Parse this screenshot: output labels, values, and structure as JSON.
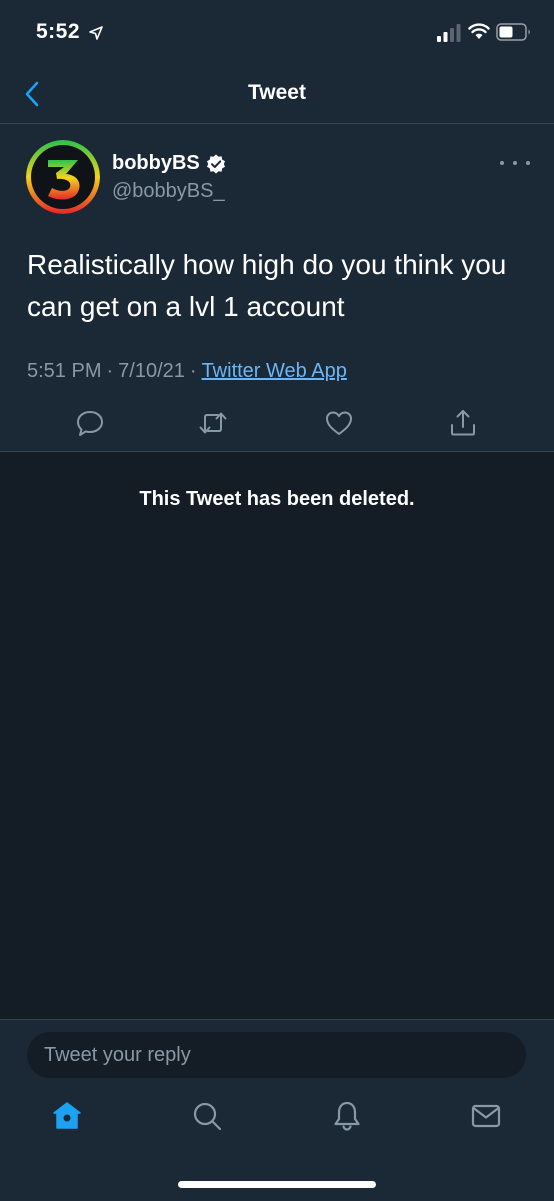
{
  "status_bar": {
    "time": "5:52"
  },
  "nav": {
    "title": "Tweet",
    "back_icon": "chevron-left-icon"
  },
  "tweet": {
    "display_name": "bobbyBS",
    "handle": "@bobbyBS_",
    "text": "Realistically how high do you think you can get on a lvl 1 account",
    "time": "5:51 PM",
    "date": "7/10/21",
    "separator": "·",
    "source": "Twitter Web App",
    "avatar_digit": "3"
  },
  "deleted_notice": "This Tweet has been deleted.",
  "compose": {
    "placeholder": "Tweet your reply"
  },
  "colors": {
    "accent": "#1da1f2",
    "background": "#141d26",
    "surface": "#1b2836",
    "muted": "#8899a6"
  }
}
